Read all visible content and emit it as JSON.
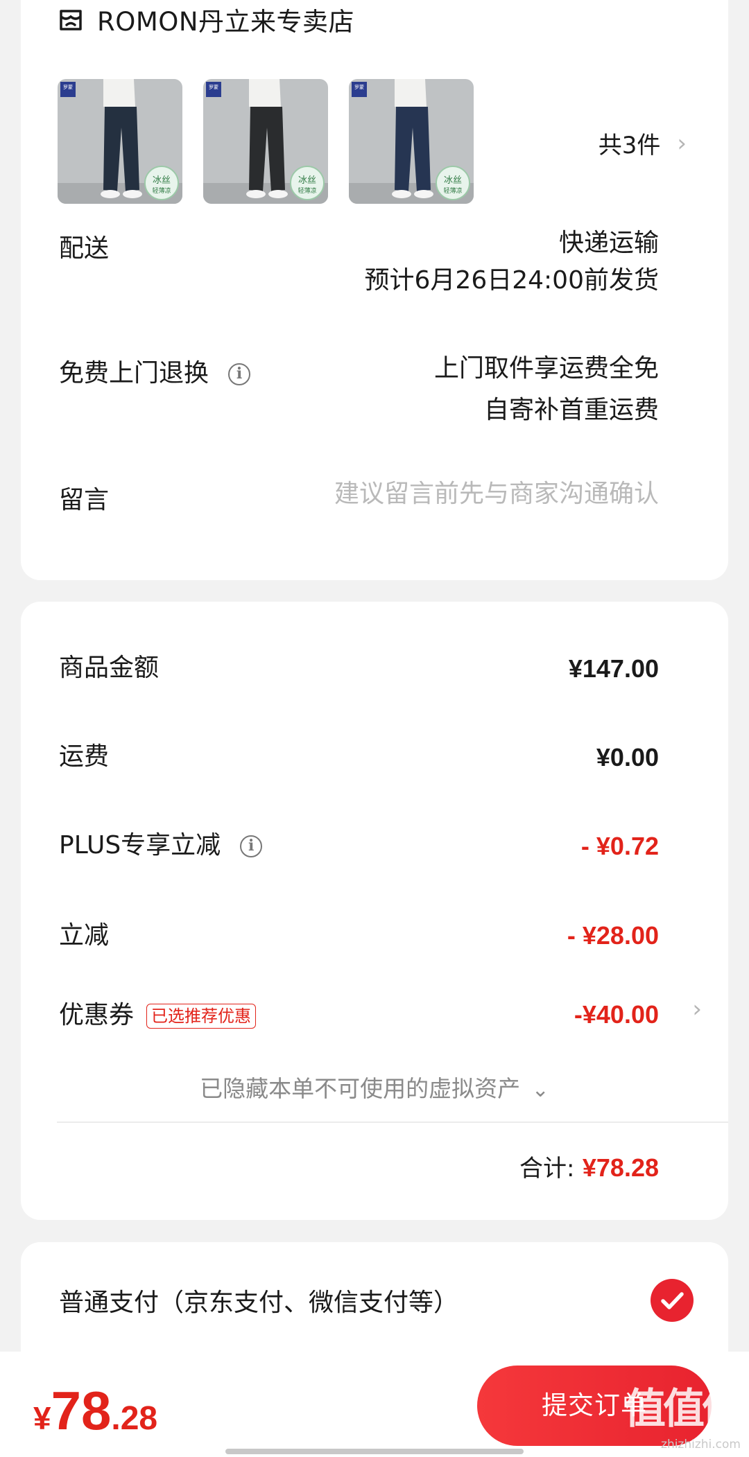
{
  "store": {
    "name": "ROMON丹立来专卖店",
    "icon": "store-icon"
  },
  "products": {
    "thumbs": [
      {
        "brand_tag": "罗蒙",
        "badge": "冰丝",
        "badge_sub": "轻薄凉",
        "pants_color": "#243040"
      },
      {
        "brand_tag": "罗蒙",
        "badge": "冰丝",
        "badge_sub": "轻薄凉",
        "pants_color": "#2a2c2e"
      },
      {
        "brand_tag": "罗蒙",
        "badge": "冰丝",
        "badge_sub": "轻薄凉",
        "pants_color": "#263552"
      }
    ],
    "count_label": "共3件",
    "chevron": "›"
  },
  "delivery": {
    "label": "配送",
    "method": "快递运输",
    "eta": "预计6月26日24:00前发货"
  },
  "returns": {
    "label": "免费上门退换",
    "info_icon": "i",
    "line1": "上门取件享运费全免",
    "line2": "自寄补首重运费"
  },
  "message": {
    "label": "留言",
    "placeholder": "建议留言前先与商家沟通确认"
  },
  "price_summary": {
    "goods_label": "商品金额",
    "goods_value": "¥147.00",
    "shipping_label": "运费",
    "shipping_value": "¥0.00",
    "plus_label": "PLUS专享立减",
    "plus_info": "i",
    "plus_value": "- ¥0.72",
    "instant_label": "立减",
    "instant_value": "- ¥28.00",
    "coupon_label": "优惠券",
    "coupon_badge": "已选推荐优惠",
    "coupon_value": "-¥40.00",
    "coupon_chevron": "›",
    "hidden_assets": "已隐藏本单不可使用的虚拟资产",
    "hidden_chevron": "⌄",
    "total_label": "合计:",
    "total_value": "¥78.28"
  },
  "payment": {
    "method_label": "普通支付（京东支付、微信支付等）",
    "selected": true
  },
  "bottom_bar": {
    "currency": "¥",
    "amount_int": "78",
    "amount_dec": ".28",
    "submit_label": "提交订单",
    "watermark": "值值值",
    "watermark_sub": "zhizhizhi.com"
  },
  "colors": {
    "accent": "#e2231a",
    "button": "#e8232f",
    "background": "#f2f2f2"
  }
}
